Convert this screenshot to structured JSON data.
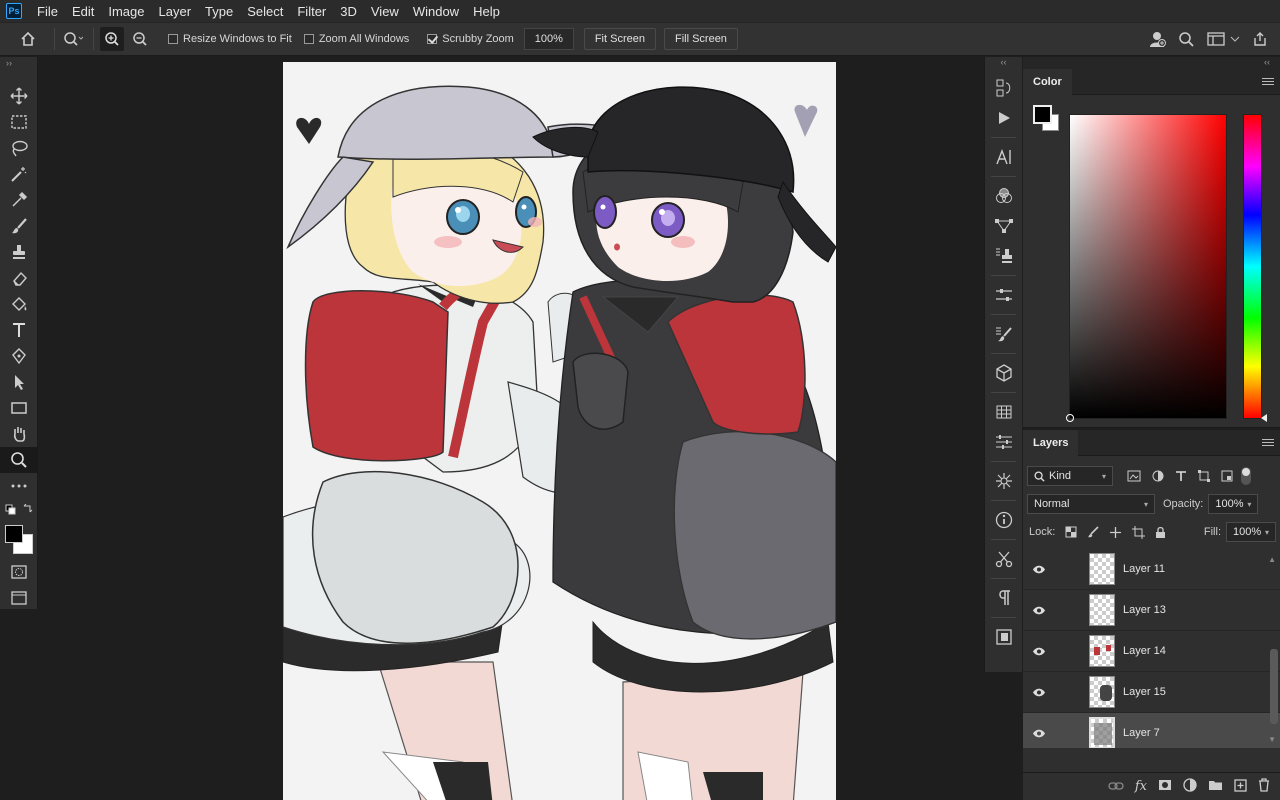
{
  "app": {
    "logo": "Ps"
  },
  "menu": [
    "File",
    "Edit",
    "Image",
    "Layer",
    "Type",
    "Select",
    "Filter",
    "3D",
    "View",
    "Window",
    "Help"
  ],
  "options": {
    "resize_windows": {
      "label": "Resize Windows to Fit",
      "checked": false
    },
    "zoom_all": {
      "label": "Zoom All Windows",
      "checked": false
    },
    "scrubby": {
      "label": "Scrubby Zoom",
      "checked": true
    },
    "zoom_value": "100%",
    "fit_screen": "Fit Screen",
    "fill_screen": "Fill Screen"
  },
  "color_panel": {
    "tab": "Color",
    "foreground": "#000000",
    "background": "#ffffff",
    "hue_base": "#ff0000"
  },
  "layers_panel": {
    "tab": "Layers",
    "filter_kind": "Kind",
    "blend_mode": "Normal",
    "opacity_label": "Opacity:",
    "opacity_value": "100%",
    "lock_label": "Lock:",
    "fill_label": "Fill:",
    "fill_value": "100%",
    "layers": [
      {
        "name": "Layer 11",
        "visible": true,
        "selected": false
      },
      {
        "name": "Layer 13",
        "visible": true,
        "selected": false
      },
      {
        "name": "Layer 14",
        "visible": true,
        "selected": false
      },
      {
        "name": "Layer 15",
        "visible": true,
        "selected": false
      },
      {
        "name": "Layer 7",
        "visible": true,
        "selected": true
      }
    ]
  }
}
